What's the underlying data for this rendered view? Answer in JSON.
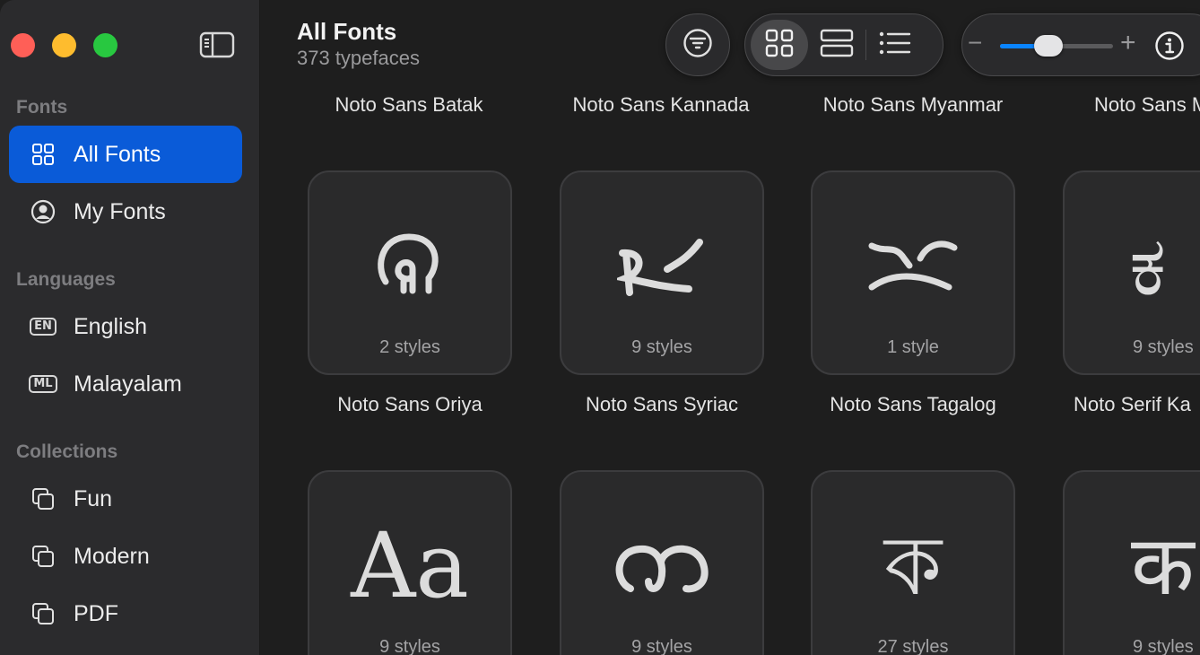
{
  "window": {
    "traffic_lights": [
      "#ff5f57",
      "#febc2e",
      "#28c840"
    ]
  },
  "sidebar": {
    "sections": [
      {
        "heading": "Fonts",
        "items": [
          {
            "label": "All Fonts",
            "icon": "grid-icon",
            "active": true
          },
          {
            "label": "My Fonts",
            "icon": "person-circle-icon",
            "active": false
          }
        ]
      },
      {
        "heading": "Languages",
        "items": [
          {
            "label": "English",
            "icon": "language-badge-icon",
            "badge": "EN"
          },
          {
            "label": "Malayalam",
            "icon": "language-badge-icon",
            "badge": "ML"
          }
        ]
      },
      {
        "heading": "Collections",
        "items": [
          {
            "label": "Fun",
            "icon": "collection-icon"
          },
          {
            "label": "Modern",
            "icon": "collection-icon"
          },
          {
            "label": "PDF",
            "icon": "collection-icon"
          }
        ]
      }
    ],
    "accent": "#0a5bd8"
  },
  "header": {
    "title": "All Fonts",
    "subtitle": "373 typefaces"
  },
  "toolbar": {
    "filter_icon": "filter-icon",
    "view_modes": [
      "grid-view-icon",
      "row-view-icon",
      "list-view-icon"
    ],
    "selected_view": "grid-view-icon",
    "zoom_out": "−",
    "zoom_in": "+",
    "zoom_level": 0.4,
    "info_icon": "info-icon"
  },
  "grid": {
    "top_row_names": [
      "Noto Sans Batak",
      "Noto Sans Kannada",
      "Noto Sans Myanmar",
      "Noto Sans M"
    ],
    "row1": [
      {
        "glyph": "ଜ",
        "styles": "2 styles",
        "name": "Noto Sans Oriya"
      },
      {
        "glyph": "ܟ",
        "styles": "9 styles",
        "name": "Noto Sans Syriac"
      },
      {
        "glyph": "ᜀ",
        "styles": "1 style",
        "name": "Noto Sans Tagalog"
      },
      {
        "glyph": "ಕ",
        "styles": "9 styles",
        "name": "Noto Serif Ka"
      }
    ],
    "row2": [
      {
        "glyph": "Aa",
        "styles": "9 styles"
      },
      {
        "glyph": "ത",
        "styles": "9 styles"
      },
      {
        "glyph": "ক",
        "styles": "27 styles"
      },
      {
        "glyph": "क",
        "styles": "9 styles"
      }
    ]
  }
}
